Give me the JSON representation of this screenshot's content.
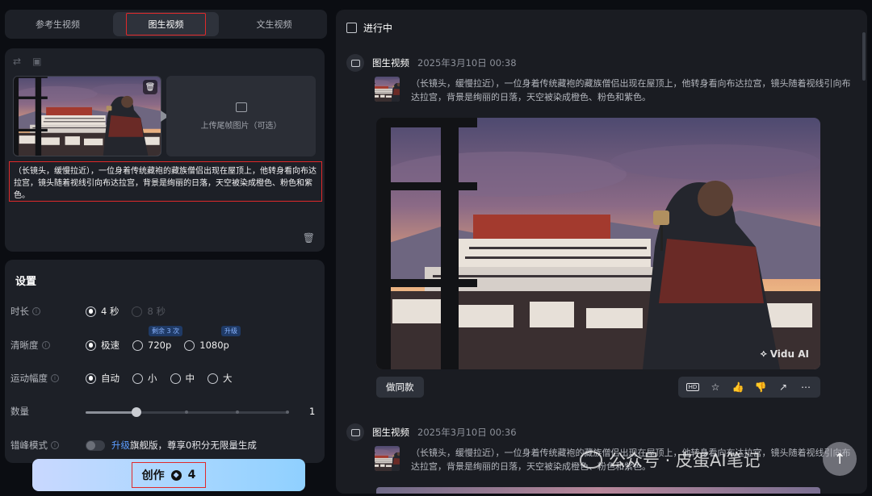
{
  "left": {
    "tabs": [
      {
        "label": "参考生视频"
      },
      {
        "label": "图生视频"
      },
      {
        "label": "文生视频"
      }
    ],
    "upload": {
      "end_frame_label": "上传尾帧图片（可选）",
      "prompt": "（长镜头，缓慢拉近），一位身着传统藏袍的藏族僧侣出现在屋顶上，他转身看向布达拉宫，镜头随着视线引向布达拉宫，背景是绚丽的日落，天空被染成橙色、粉色和紫色。"
    },
    "settings": {
      "title": "设置",
      "duration": {
        "label": "时长",
        "options": [
          "4 秒",
          "8 秒"
        ],
        "selected": "4 秒"
      },
      "quality": {
        "label": "清晰度",
        "options": [
          "极速",
          "720p",
          "1080p"
        ],
        "selected": "极速",
        "badge_720": "剩余 3 次",
        "badge_1080": "升级"
      },
      "motion": {
        "label": "运动幅度",
        "options": [
          "自动",
          "小",
          "中",
          "大"
        ],
        "selected": "自动"
      },
      "count": {
        "label": "数量",
        "value": "1",
        "level": 0.25
      },
      "offpeak": {
        "label": "错峰模式",
        "upgrade": "升级",
        "text": "旗舰版，尊享0积分无限量生成"
      }
    },
    "create": {
      "label": "创作",
      "cost": "4"
    }
  },
  "right": {
    "filter_label": "进行中",
    "tasks": [
      {
        "type": "图生视频",
        "time": "2025年3月10日 00:38",
        "prompt": "（长镜头，缓慢拉近），一位身着传统藏袍的藏族僧侣出现在屋顶上，他转身看向布达拉宫，镜头随着视线引向布达拉宫，背景是绚丽的日落，天空被染成橙色、粉色和紫色。",
        "watermark": "Vidu AI",
        "same_label": "做同款",
        "actions": [
          "hd-icon",
          "star-icon",
          "thumbs-up-icon",
          "thumbs-down-icon",
          "share-icon",
          "more-icon"
        ]
      },
      {
        "type": "图生视频",
        "time": "2025年3月10日 00:36",
        "prompt": "（长镜头，缓慢拉近），一位身着传统藏袍的藏族僧侣出现在屋顶上，他转身看向布达拉宫，镜头随着视线引向布达拉宫，背景是绚丽的日落，天空被染成橙色、粉色和紫色。"
      }
    ]
  },
  "overlay_watermark": "公众号 · 皮蛋AI笔记",
  "colors": {
    "highlight": "#e0292a",
    "accent": "#8ab4ff",
    "panel": "#1d2027"
  }
}
